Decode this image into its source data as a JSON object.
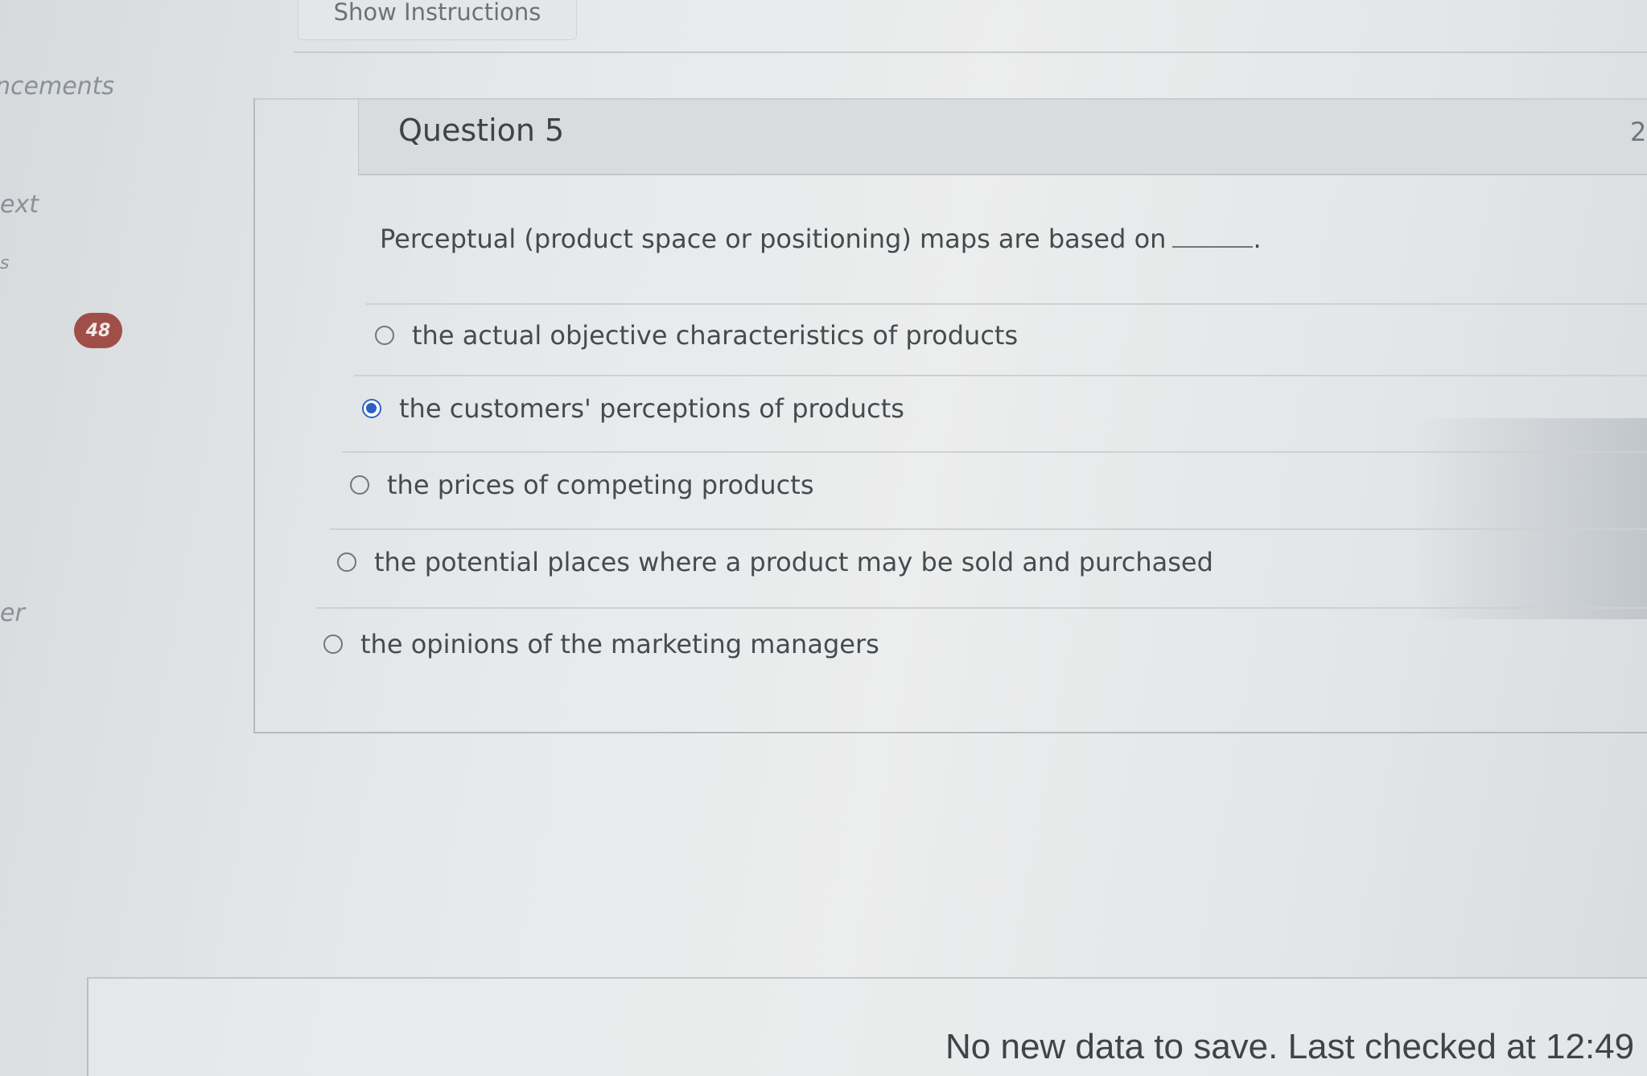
{
  "sidebar": {
    "items": [
      {
        "label": "ncements"
      },
      {
        "label": "ext"
      },
      {
        "label": "s"
      },
      {
        "label": "er"
      }
    ],
    "badge_count": "48"
  },
  "toolbar": {
    "show_instructions_label": "Show Instructions"
  },
  "question": {
    "title": "Question 5",
    "points_fragment": "2",
    "prompt": "Perceptual (product space or positioning) maps are based on",
    "prompt_end": ".",
    "answers": [
      {
        "label": "the actual objective characteristics of products",
        "selected": false
      },
      {
        "label": "the customers' perceptions of products",
        "selected": true
      },
      {
        "label": "the prices of competing products",
        "selected": false
      },
      {
        "label": "the potential places where a product may be sold and purchased",
        "selected": false
      },
      {
        "label": "the opinions of the marketing managers",
        "selected": false
      }
    ]
  },
  "footer": {
    "save_status": "No new data to save. Last checked at 12:49"
  },
  "colors": {
    "selected_radio": "#2b5fc2",
    "badge": "#a04f48"
  }
}
